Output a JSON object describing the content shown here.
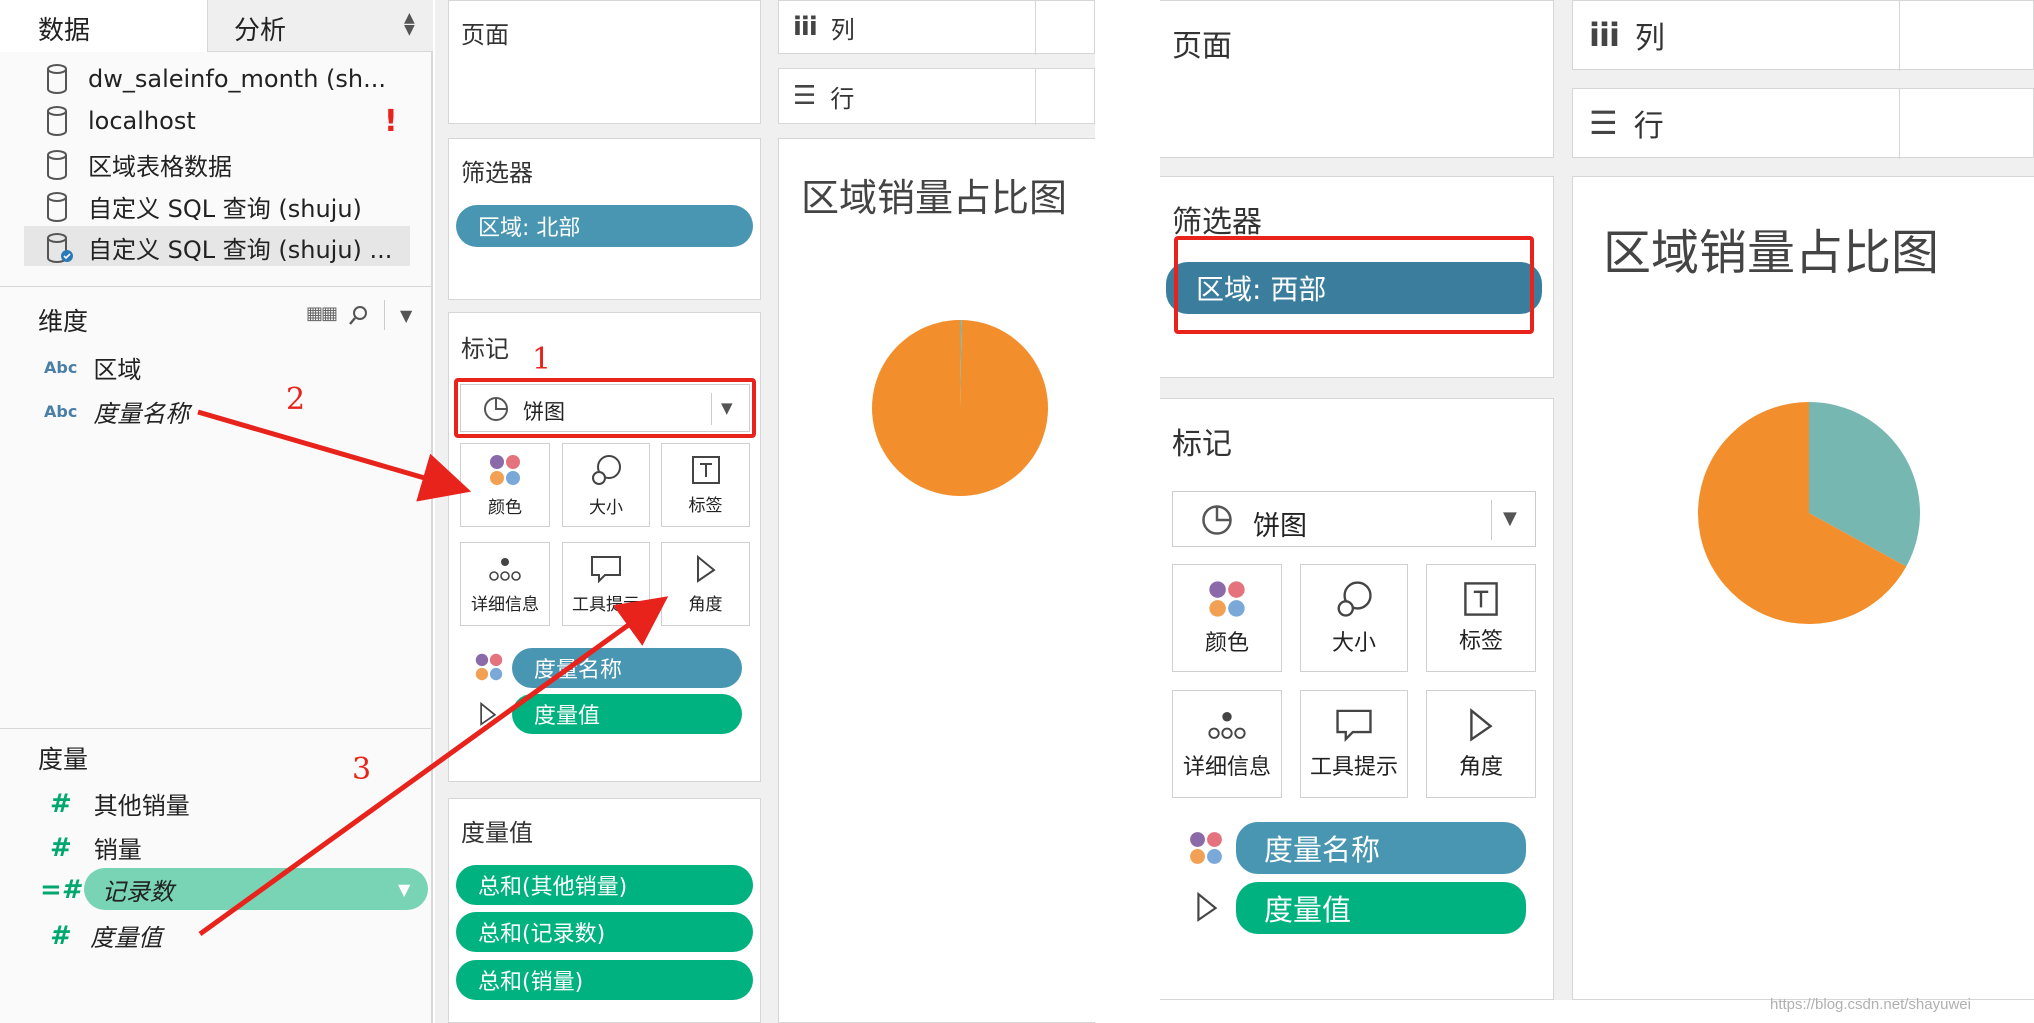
{
  "left_shot": {
    "data_pane": {
      "tabs": [
        "数据",
        "分析"
      ],
      "sources": [
        "dw_saleinfo_month (sh...",
        "localhost",
        "区域表格数据",
        "自定义 SQL 查询 (shuju)",
        "自定义 SQL 查询 (shuju) ..."
      ],
      "localhost_alert": "!",
      "dimensions_title": "维度",
      "dimension_type_label": "Abc",
      "dimensions": [
        "区域",
        "度量名称"
      ],
      "measures_title": "度量",
      "measures": [
        "其他销量",
        "销量",
        "记录数",
        "度量值"
      ]
    },
    "pages_title": "页面",
    "filters_title": "筛选器",
    "filter_pill": "区域: 北部",
    "marks_title": "标记",
    "mark_type": "饼图",
    "mark_buttons": [
      "颜色",
      "大小",
      "标签",
      "详细信息",
      "工具提示",
      "角度"
    ],
    "mark_pills": [
      "度量名称",
      "度量值"
    ],
    "measure_values_title": "度量值",
    "measure_value_pills": [
      "总和(其他销量)",
      "总和(记录数)",
      "总和(销量)"
    ],
    "columns_label": "列",
    "rows_label": "行",
    "chart_title": "区域销量占比图",
    "annotations": [
      "1",
      "2",
      "3"
    ]
  },
  "right_shot": {
    "pages_title": "页面",
    "columns_label": "列",
    "rows_label": "行",
    "filters_title": "筛选器",
    "filter_pill": "区域: 西部",
    "marks_title": "标记",
    "mark_type": "饼图",
    "mark_buttons": [
      "颜色",
      "大小",
      "标签",
      "详细信息",
      "工具提示",
      "角度"
    ],
    "mark_pills": [
      "度量名称",
      "度量值"
    ],
    "chart_title": "区域销量占比图"
  },
  "watermark": "https://blog.csdn.net/shayuwei",
  "colors": {
    "orange": "#f28e2b",
    "teal": "#76b7b2",
    "pill_blue": "#4996b2",
    "pill_green": "#00b27f",
    "annotation_red": "#e8231c"
  },
  "chart_data": [
    {
      "type": "pie",
      "title": "区域销量占比图",
      "slices": [
        {
          "color": "#76b7b2",
          "fraction": 0.003
        },
        {
          "color": "#f28e2b",
          "fraction": 0.997
        }
      ]
    },
    {
      "type": "pie",
      "title": "区域销量占比图",
      "slices": [
        {
          "color": "#76b7b2",
          "fraction": 0.33
        },
        {
          "color": "#f28e2b",
          "fraction": 0.67
        }
      ]
    }
  ]
}
